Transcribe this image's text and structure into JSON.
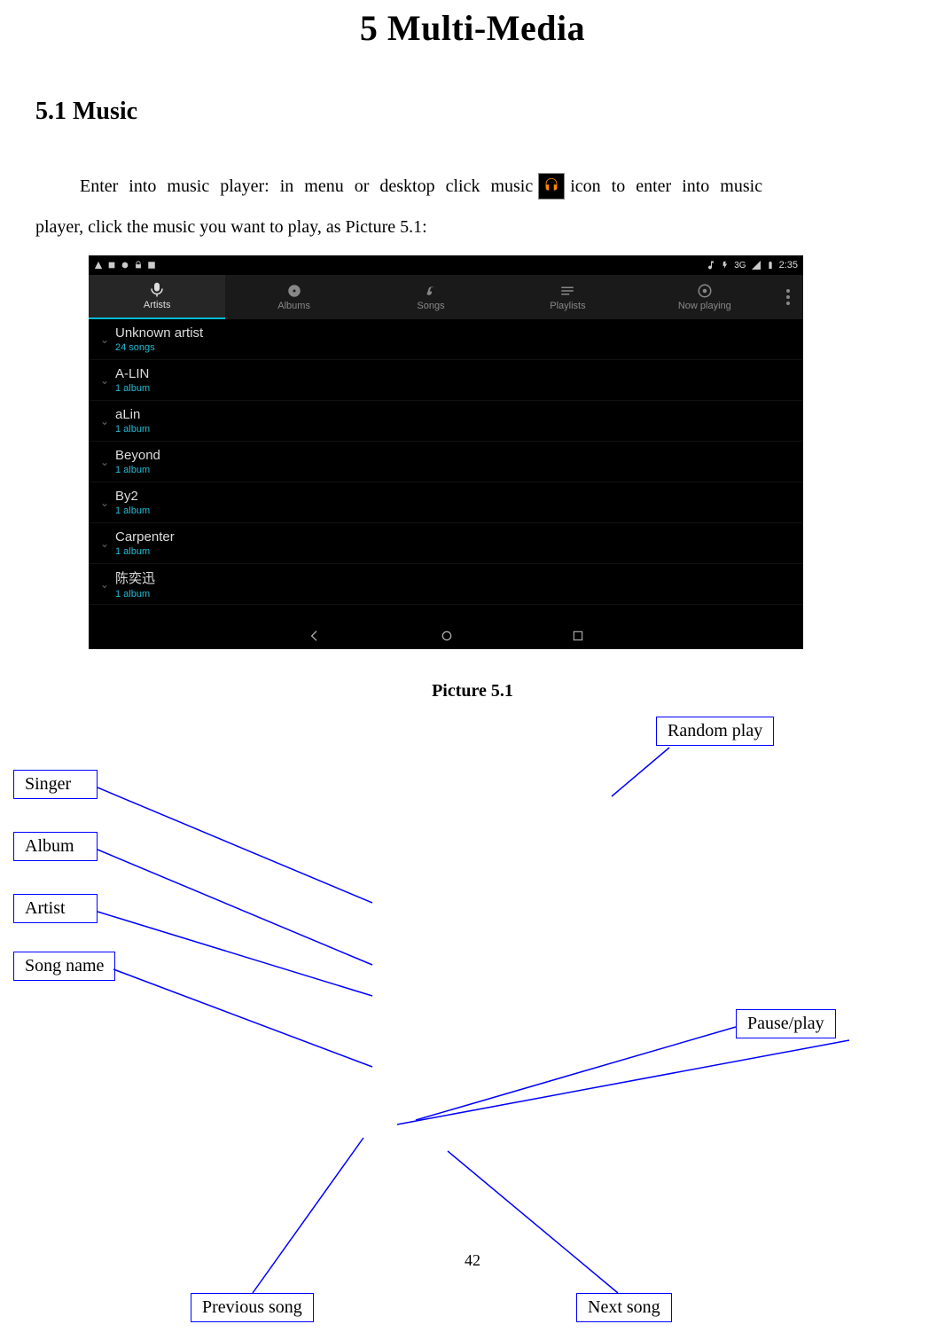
{
  "chapter": "5 Multi-Media",
  "section": "5.1 Music",
  "body": {
    "line1a": "Enter  into  music  player:  in  menu  or  desktop  click  music",
    "line1b": "icon  to  enter  into  music",
    "line2": "player, click the music you want to play, as Picture 5.1:"
  },
  "caption": "Picture 5.1",
  "page_number": "42",
  "status": {
    "net": "3G",
    "time": "2:35"
  },
  "tabs": [
    {
      "label": "Artists",
      "active": true
    },
    {
      "label": "Albums",
      "active": false
    },
    {
      "label": "Songs",
      "active": false
    },
    {
      "label": "Playlists",
      "active": false
    },
    {
      "label": "Now playing",
      "active": false
    }
  ],
  "artists": [
    {
      "name": "Unknown artist",
      "sub": "24 songs"
    },
    {
      "name": "A-LIN",
      "sub": "1 album"
    },
    {
      "name": "aLin",
      "sub": "1 album"
    },
    {
      "name": "Beyond",
      "sub": "1 album"
    },
    {
      "name": "By2",
      "sub": "1 album"
    },
    {
      "name": "Carpenter",
      "sub": "1 album"
    },
    {
      "name": "陈奕迅",
      "sub": "1 album"
    }
  ],
  "callouts": {
    "random_play": "Random play",
    "singer": "Singer",
    "album": "Album",
    "artist": "Artist",
    "song_name": "Song name",
    "pause_play": "Pause/play",
    "previous_song": "Previous song",
    "next_song": "Next song"
  }
}
